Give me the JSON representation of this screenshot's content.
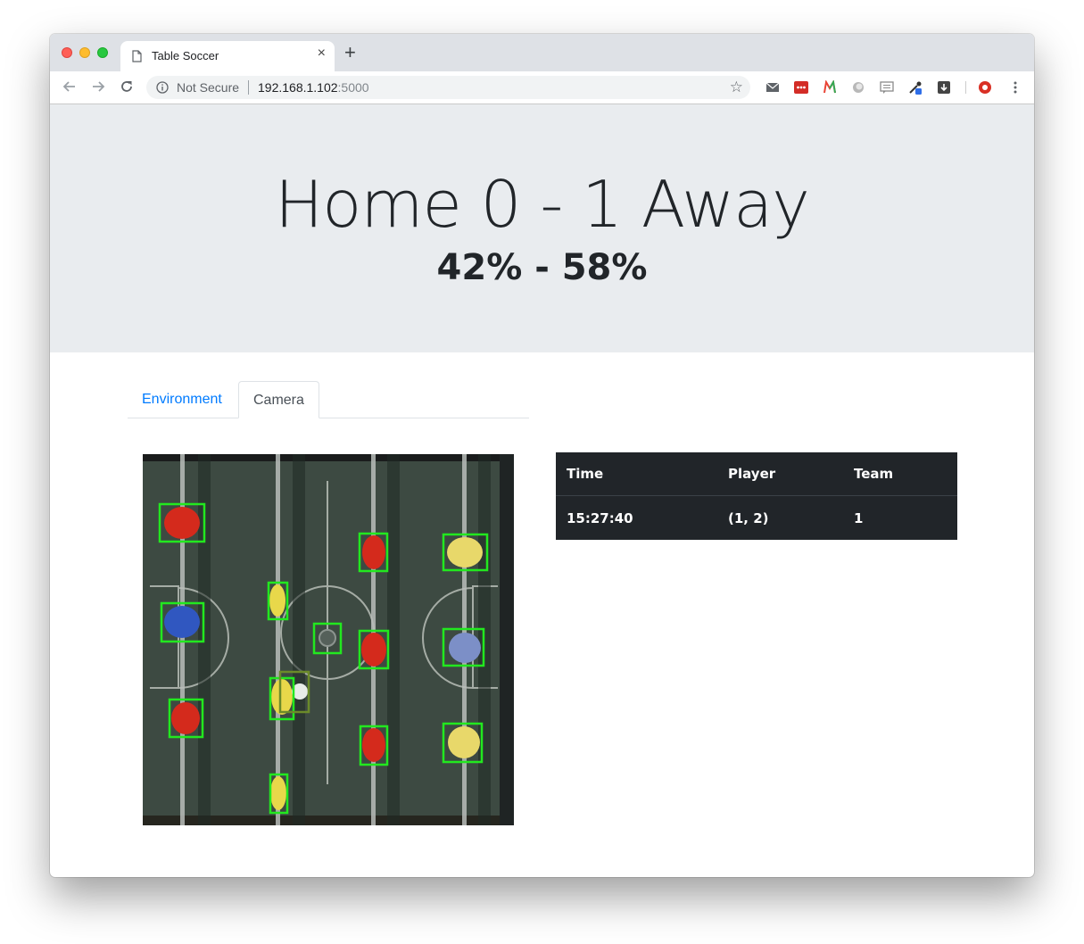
{
  "browser": {
    "tab_title": "Table Soccer",
    "new_tab": "+",
    "close_glyph": "×",
    "security_label": "Not Secure",
    "url_host": "192.168.1.102",
    "url_port": ":5000",
    "star_glyph": "☆"
  },
  "scoreboard": {
    "score_line": "Home 0 - 1 Away",
    "possession_line": "42% - 58%"
  },
  "tabs": {
    "environment_label": "Environment",
    "camera_label": "Camera"
  },
  "events_table": {
    "columns": [
      "Time",
      "Player",
      "Team"
    ],
    "rows": [
      {
        "time": "15:27:40",
        "player": "(1, 2)",
        "team": "1"
      }
    ]
  },
  "icons": {
    "back": "arrow-left-icon",
    "forward": "arrow-right-icon",
    "reload": "reload-icon",
    "info": "info-icon",
    "star": "star-icon",
    "menu": "more-vert-icon"
  },
  "colors": {
    "link": "#007bff",
    "table_bg": "#212529",
    "jumbotron_bg": "#e9ecef",
    "detection_box": "#22e81f"
  }
}
